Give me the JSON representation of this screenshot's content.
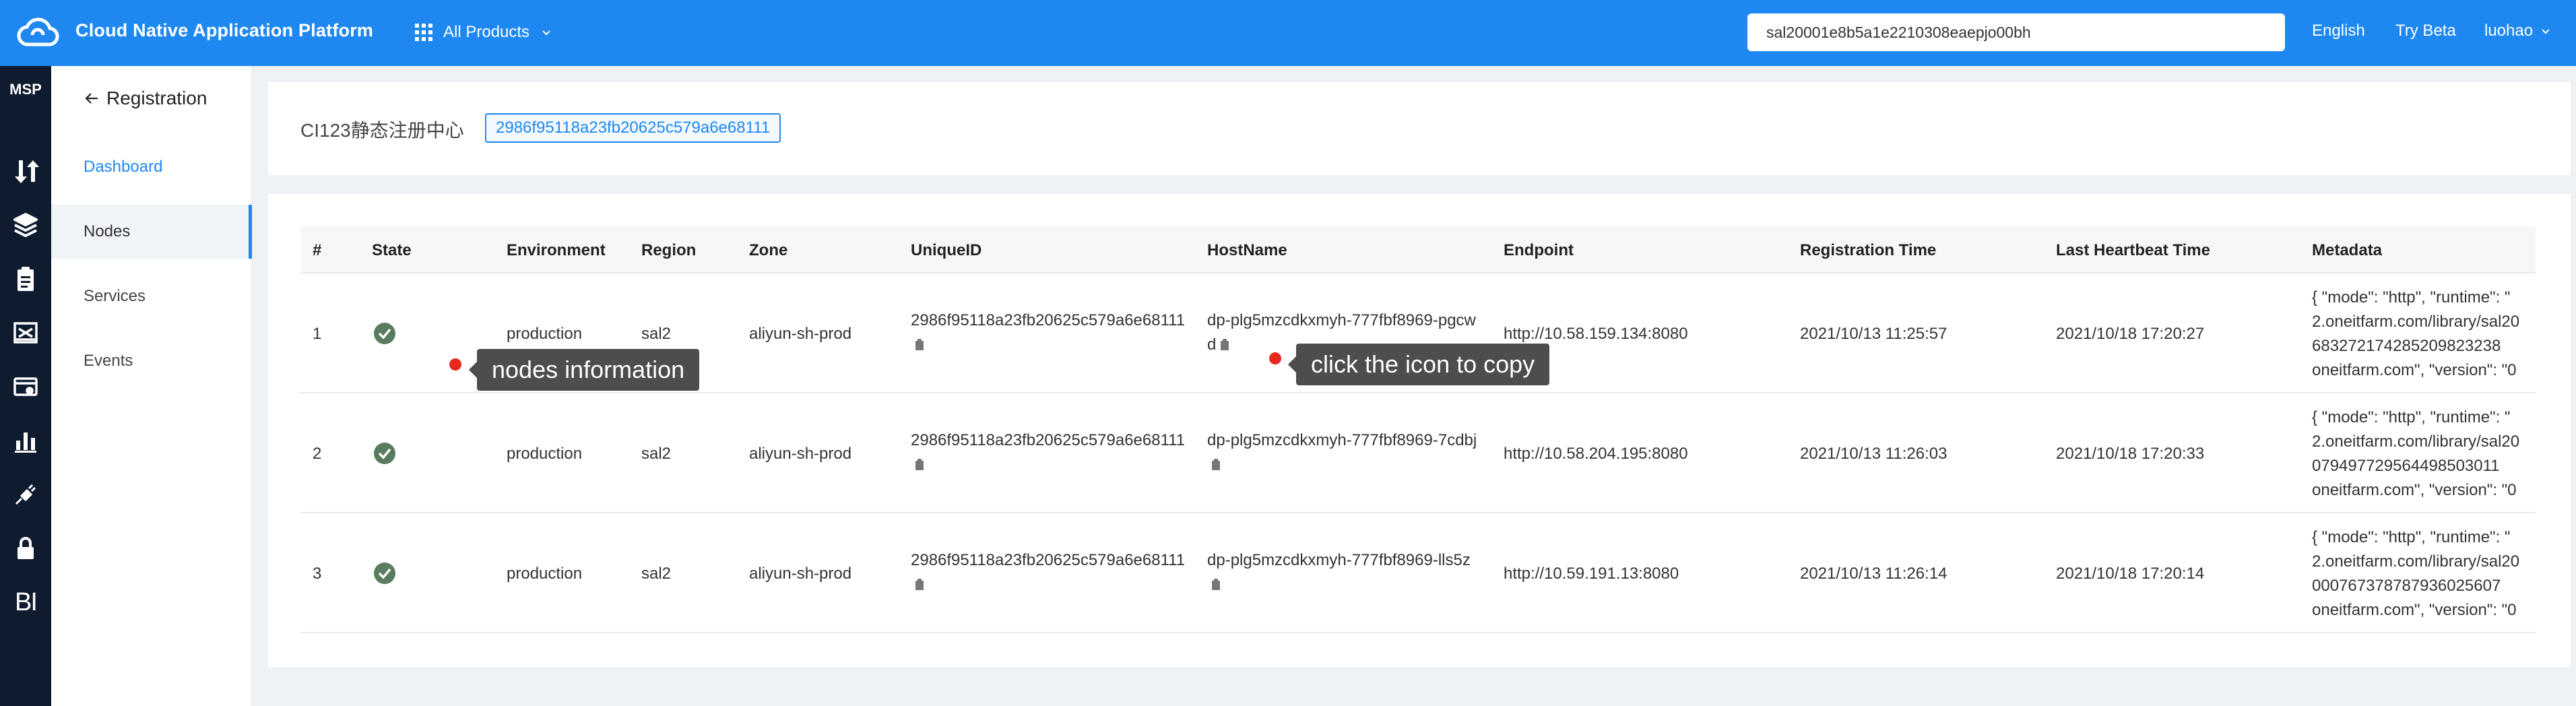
{
  "topbar": {
    "title": "Cloud Native Application Platform",
    "products_label": "All Products",
    "search_value": "sal20001e8b5a1e2210308eaepjo00bh",
    "language": "English",
    "try_beta": "Try Beta",
    "user": "luohao"
  },
  "rail": {
    "brand": "MSP",
    "bi_label": "BI",
    "icons": [
      "transfer-icon",
      "layers-icon",
      "clipboard-icon",
      "monitor-icon",
      "card-icon",
      "bar-chart-icon",
      "plug-icon",
      "lock-icon"
    ]
  },
  "subnav": {
    "back_label": "Registration",
    "items": [
      {
        "label": "Dashboard"
      },
      {
        "label": "Nodes"
      },
      {
        "label": "Services"
      },
      {
        "label": "Events"
      }
    ]
  },
  "header": {
    "registry_name": "CI123静态注册中心",
    "registry_id": "2986f95118a23fb20625c579a6e68111"
  },
  "table": {
    "columns": [
      "#",
      "State",
      "Environment",
      "Region",
      "Zone",
      "UniqueID",
      "HostName",
      "Endpoint",
      "Registration Time",
      "Last Heartbeat Time",
      "Metadata"
    ],
    "rows": [
      {
        "index": "1",
        "environment": "production",
        "region": "sal2",
        "zone": "aliyun-sh-prod",
        "unique_id": "2986f95118a23fb20625c579a6e68111",
        "hostname": "dp-plg5mzcdkxmyh-777fbf8969-pgcwd",
        "endpoint": "http://10.58.159.134:8080",
        "registration_time": "2021/10/13 11:25:57",
        "heartbeat_time": "2021/10/18 17:20:27",
        "metadata": [
          "{ \"mode\": \"http\", \"runtime\": \"",
          "2.oneitfarm.com/library/sal20",
          "683272174285209823238",
          "oneitfarm.com\", \"version\": \"0"
        ]
      },
      {
        "index": "2",
        "environment": "production",
        "region": "sal2",
        "zone": "aliyun-sh-prod",
        "unique_id": "2986f95118a23fb20625c579a6e68111",
        "hostname": "dp-plg5mzcdkxmyh-777fbf8969-7cdbj",
        "endpoint": "http://10.58.204.195:8080",
        "registration_time": "2021/10/13 11:26:03",
        "heartbeat_time": "2021/10/18 17:20:33",
        "metadata": [
          "{ \"mode\": \"http\", \"runtime\": \"",
          "2.oneitfarm.com/library/sal20",
          "079497729564498503011",
          "oneitfarm.com\", \"version\": \"0"
        ]
      },
      {
        "index": "3",
        "environment": "production",
        "region": "sal2",
        "zone": "aliyun-sh-prod",
        "unique_id": "2986f95118a23fb20625c579a6e68111",
        "hostname": "dp-plg5mzcdkxmyh-777fbf8969-lls5z",
        "endpoint": "http://10.59.191.13:8080",
        "registration_time": "2021/10/13 11:26:14",
        "heartbeat_time": "2021/10/18 17:20:14",
        "metadata": [
          "{ \"mode\": \"http\", \"runtime\": \"",
          "2.oneitfarm.com/library/sal20",
          "000767378787936025607",
          "oneitfarm.com\", \"version\": \"0"
        ]
      }
    ]
  },
  "annotations": {
    "nodes_info": "nodes information",
    "copy_hint": "click the icon to copy"
  },
  "colors": {
    "primary": "#1e88f0",
    "rail": "#0f1c30",
    "success": "#5b7b5e",
    "tooltip": "#4d4d4d",
    "marker": "#e8271d"
  }
}
